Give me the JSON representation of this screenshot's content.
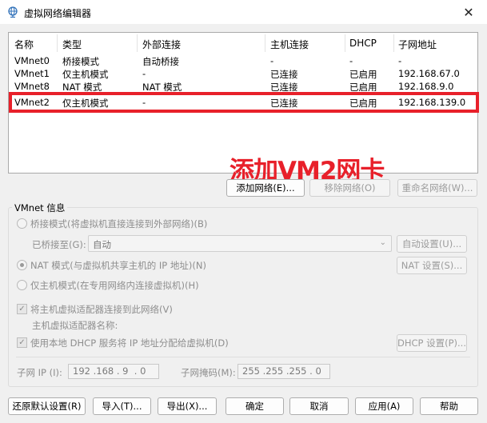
{
  "window": {
    "title": "虚拟网络编辑器",
    "close_glyph": "✕"
  },
  "table": {
    "headers": [
      "名称",
      "类型",
      "外部连接",
      "主机连接",
      "DHCP",
      "子网地址"
    ],
    "rows": [
      [
        "VMnet0",
        "桥接模式",
        "自动桥接",
        "-",
        "-",
        "-"
      ],
      [
        "VMnet1",
        "仅主机模式",
        "-",
        "已连接",
        "已启用",
        "192.168.67.0"
      ],
      [
        "VMnet8",
        "NAT 模式",
        "NAT 模式",
        "已连接",
        "已启用",
        "192.168.9.0"
      ],
      [
        "VMnet2",
        "仅主机模式",
        "-",
        "已连接",
        "已启用",
        "192.168.139.0"
      ]
    ]
  },
  "annotation": "添加VM2网卡",
  "list_buttons": {
    "add": "添加网络(E)...",
    "remove": "移除网络(O)",
    "rename": "重命名网络(W)..."
  },
  "vmnet_info": {
    "group_title": "VMnet 信息",
    "bridged_label": "桥接模式(将虚拟机直接连接到外部网络)(B)",
    "bridged_to_label": "已桥接至(G):",
    "bridged_to_value": "自动",
    "auto_settings": "自动设置(U)...",
    "nat_label": "NAT 模式(与虚拟机共享主机的 IP 地址)(N)",
    "nat_settings": "NAT 设置(S)...",
    "host_only_label": "仅主机模式(在专用网络内连接虚拟机)(H)",
    "connect_adapter_label": "将主机虚拟适配器连接到此网络(V)",
    "adapter_name_label": "主机虚拟适配器名称:",
    "dhcp_label": "使用本地 DHCP 服务将 IP 地址分配给虚拟机(D)",
    "dhcp_settings": "DHCP 设置(P)...",
    "subnet_ip_label": "子网 IP (I):",
    "subnet_ip_value": "192 .168 . 9  . 0",
    "subnet_mask_label": "子网掩码(M):",
    "subnet_mask_value": "255 .255 .255 . 0"
  },
  "footer": {
    "restore": "还原默认设置(R)",
    "import": "导入(T)...",
    "export": "导出(X)...",
    "ok": "确定",
    "cancel": "取消",
    "apply": "应用(A)",
    "help": "帮助"
  },
  "colors": {
    "annotation_red": "#e8202a",
    "background": "#f0f0f0"
  }
}
